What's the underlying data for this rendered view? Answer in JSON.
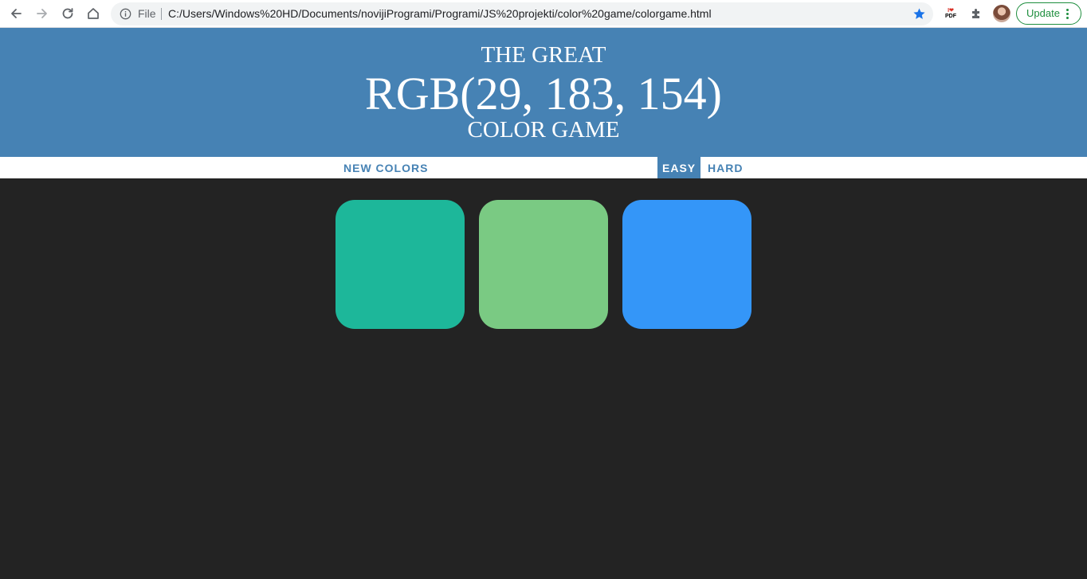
{
  "browser": {
    "scheme_label": "File",
    "url": "C:/Users/Windows%20HD/Documents/novijiProgrami/Programi/JS%20projekti/color%20game/colorgame.html",
    "update_label": "Update",
    "pdf_icon_top": "I❤",
    "pdf_icon_bottom": "PDF"
  },
  "header": {
    "line1": "THE GREAT",
    "rgb_display": "RGB(29, 183, 154)",
    "line3": "COLOR GAME",
    "background": "#4682b4"
  },
  "controls": {
    "new_colors_label": "NEW COLORS",
    "message": "",
    "easy_label": "EASY",
    "hard_label": "HARD",
    "selected_mode": "EASY"
  },
  "squares": [
    {
      "color": "rgb(29, 183, 154)"
    },
    {
      "color": "rgb(122, 202, 131)"
    },
    {
      "color": "rgb(52, 150, 248)"
    }
  ],
  "page_background": "#232323"
}
